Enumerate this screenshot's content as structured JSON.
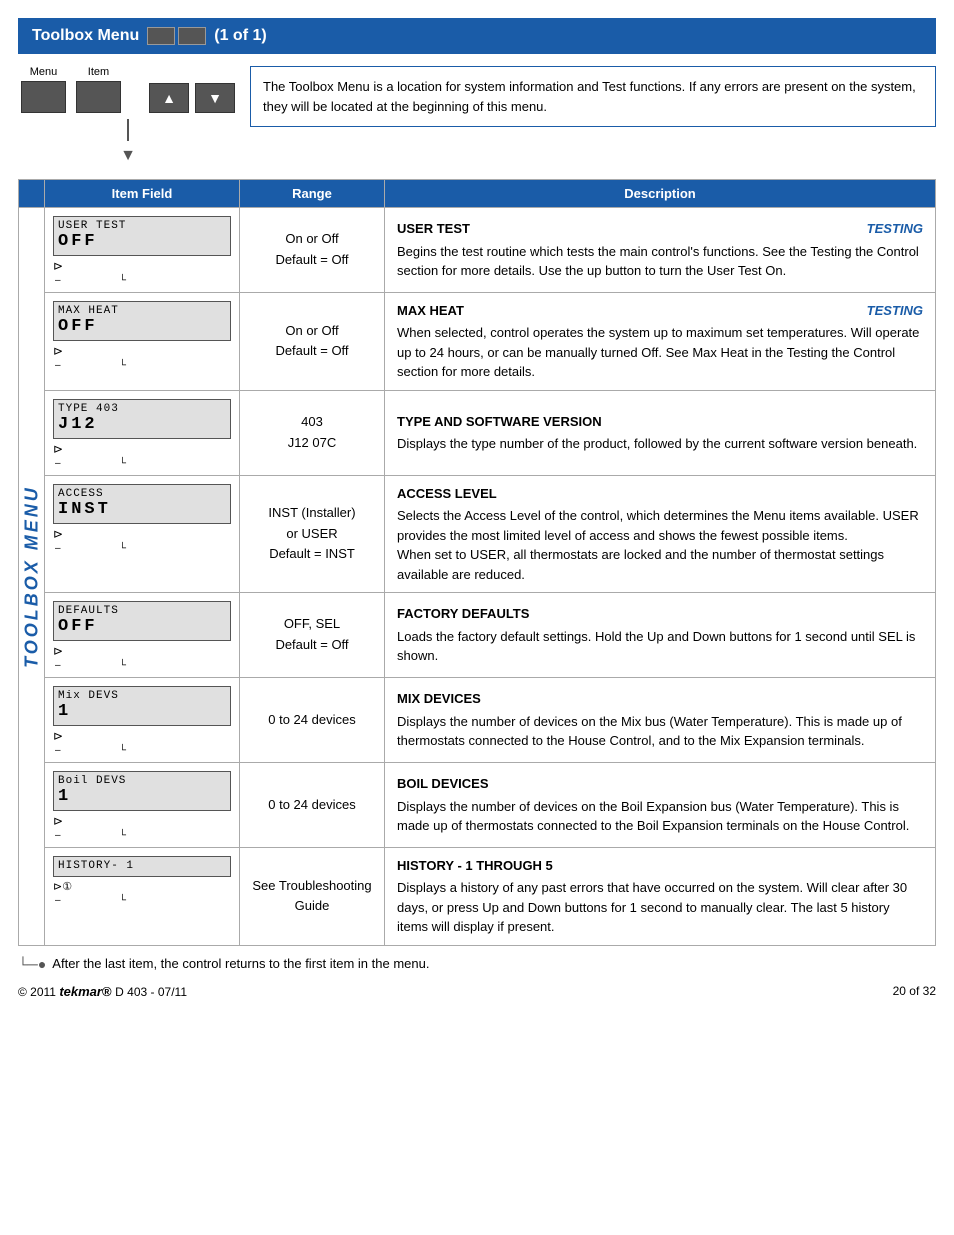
{
  "header": {
    "title": "Toolbox Menu",
    "subtitle": "(1 of 1)"
  },
  "intro": {
    "menu_label": "Menu",
    "item_label": "Item",
    "up_arrow": "▲",
    "down_arrow": "▼",
    "description": "The Toolbox Menu is a location for system information and Test functions. If any errors are present on the system, they will be located at the beginning of this menu."
  },
  "table": {
    "col_headers": [
      "Item Field",
      "Range",
      "Description"
    ],
    "rows": [
      {
        "lcd_line1": "USER TEST",
        "lcd_line2": "OFF",
        "range": "On or Off\nDefault = Off",
        "title": "USER TEST",
        "tag": "TESTING",
        "description": "Begins the test routine which tests the main control's functions. See the Testing the Control section for more details. Use the up button to turn the User Test On."
      },
      {
        "lcd_line1": "MAX HEAT",
        "lcd_line2": "OFF",
        "range": "On or Off\nDefault = Off",
        "title": "MAX HEAT",
        "tag": "TESTING",
        "description": "When selected, control operates the system up to maximum set temperatures. Will operate up to 24 hours, or can be manually turned Off. See Max Heat in the Testing the Control section for more details."
      },
      {
        "lcd_line1": "TYPE 403",
        "lcd_line2": "J12",
        "range": "403\nJ12 07C",
        "title": "TYPE AND SOFTWARE VERSION",
        "tag": "",
        "description": "Displays the type number of the product, followed by the current software version beneath."
      },
      {
        "lcd_line1": "ACCESS",
        "lcd_line2": "INST",
        "range": "INST (Installer)\nor USER\nDefault = INST",
        "title": "ACCESS LEVEL",
        "tag": "",
        "description": "Selects the Access Level of the control, which determines the Menu items available. USER provides the most limited level of access and shows the fewest possible items.\nWhen set to USER, all thermostats are locked and the number of thermostat settings available are reduced."
      },
      {
        "lcd_line1": "DEFAULTS",
        "lcd_line2": "OFF",
        "range": "OFF, SEL\nDefault = Off",
        "title": "FACTORY DEFAULTS",
        "tag": "",
        "description": "Loads the factory default settings. Hold the Up and Down buttons for 1 second until SEL is shown."
      },
      {
        "lcd_line1": "Mix DEVS",
        "lcd_line2": "1",
        "range": "0 to 24 devices",
        "title": "MIX DEVICES",
        "tag": "",
        "description": "Displays the number of devices on the Mix bus (Water Temperature). This is made up of thermostats connected to the House Control, and to the Mix Expansion terminals."
      },
      {
        "lcd_line1": "Boil DEVS",
        "lcd_line2": "1",
        "range": "0 to 24 devices",
        "title": "BOIL DEVICES",
        "tag": "",
        "description": "Displays the number of devices on the Boil Expansion bus (Water Temperature). This is made up of thermostats connected to the Boil Expansion terminals on the House Control."
      },
      {
        "lcd_line1": "HISTORY- 1",
        "lcd_line2": "",
        "range": "See Troubleshooting\nGuide",
        "title": "HISTORY - 1 THROUGH 5",
        "tag": "",
        "description": "Displays a history of any past errors that have occurred on the system. Will clear after 30 days, or press Up and Down buttons for 1 second to manually clear. The last 5 history items will display if present."
      }
    ]
  },
  "footer": {
    "note": "After the last item, the control returns to the first item in the menu.",
    "copyright": "© 2011",
    "brand": "tekmar",
    "model": "D 403 - 07/11",
    "page": "20 of 32"
  },
  "toolbox_label": "TOOLBOX MENU"
}
